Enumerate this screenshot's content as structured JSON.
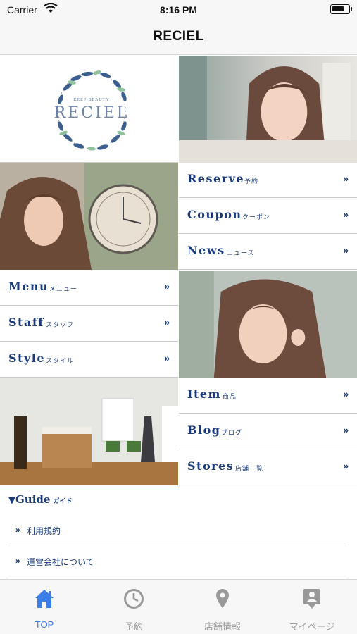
{
  "status_bar": {
    "carrier": "Carrier",
    "time": "8:16 PM"
  },
  "nav": {
    "title": "RECIEL"
  },
  "logo": {
    "small_text": "KEEP BEAUTY",
    "brand": "RECIEL"
  },
  "menu": [
    {
      "en": "Reserve",
      "jp": "予約"
    },
    {
      "en": "Coupon",
      "jp": "クーポン"
    },
    {
      "en": "News",
      "jp": "ニュース"
    },
    {
      "en": "Menu",
      "jp": "メニュー"
    },
    {
      "en": "Staff",
      "jp": "スタッフ"
    },
    {
      "en": "Style",
      "jp": "スタイル"
    },
    {
      "en": "Item",
      "jp": "商品"
    },
    {
      "en": "Blog",
      "jp": "ブログ"
    },
    {
      "en": "Stores",
      "jp": "店舗一覧"
    }
  ],
  "menu_arrow": "»",
  "guide": {
    "marker": "▼",
    "title": "Guide",
    "subtitle": "ガイド",
    "links": [
      {
        "label": "利用規約"
      },
      {
        "label": "運営会社について"
      }
    ]
  },
  "tabs": [
    {
      "label": "TOP",
      "icon": "home-icon",
      "active": true
    },
    {
      "label": "予約",
      "icon": "clock-icon",
      "active": false
    },
    {
      "label": "店舗情報",
      "icon": "map-pin-icon",
      "active": false
    },
    {
      "label": "マイページ",
      "icon": "account-icon",
      "active": false
    }
  ],
  "colors": {
    "accent": "#1a3a7a",
    "tab_active": "#3b7ee8",
    "tab_inactive": "#999999"
  }
}
